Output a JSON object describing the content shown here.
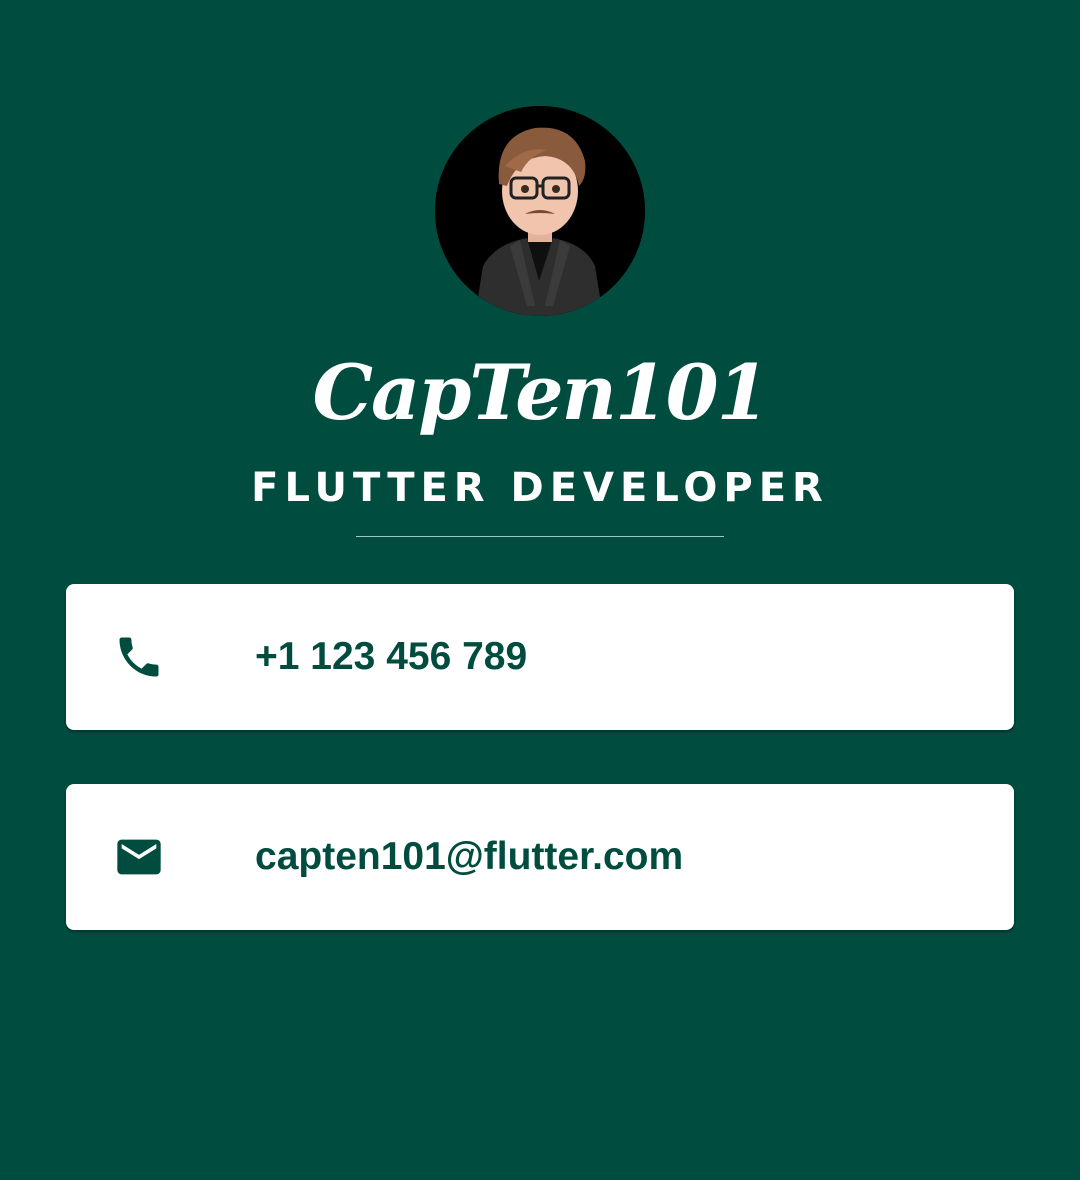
{
  "profile": {
    "name": "CapTen101",
    "title": "FLUTTER DEVELOPER",
    "avatar_icon": "avatar-image"
  },
  "contacts": [
    {
      "icon": "phone-icon",
      "value": "+1 123 456 789"
    },
    {
      "icon": "mail-icon",
      "value": "capten101@flutter.com"
    }
  ],
  "colors": {
    "background": "#004d40",
    "card": "#ffffff",
    "accent_text": "#004d40",
    "divider": "#9fc8c0"
  }
}
